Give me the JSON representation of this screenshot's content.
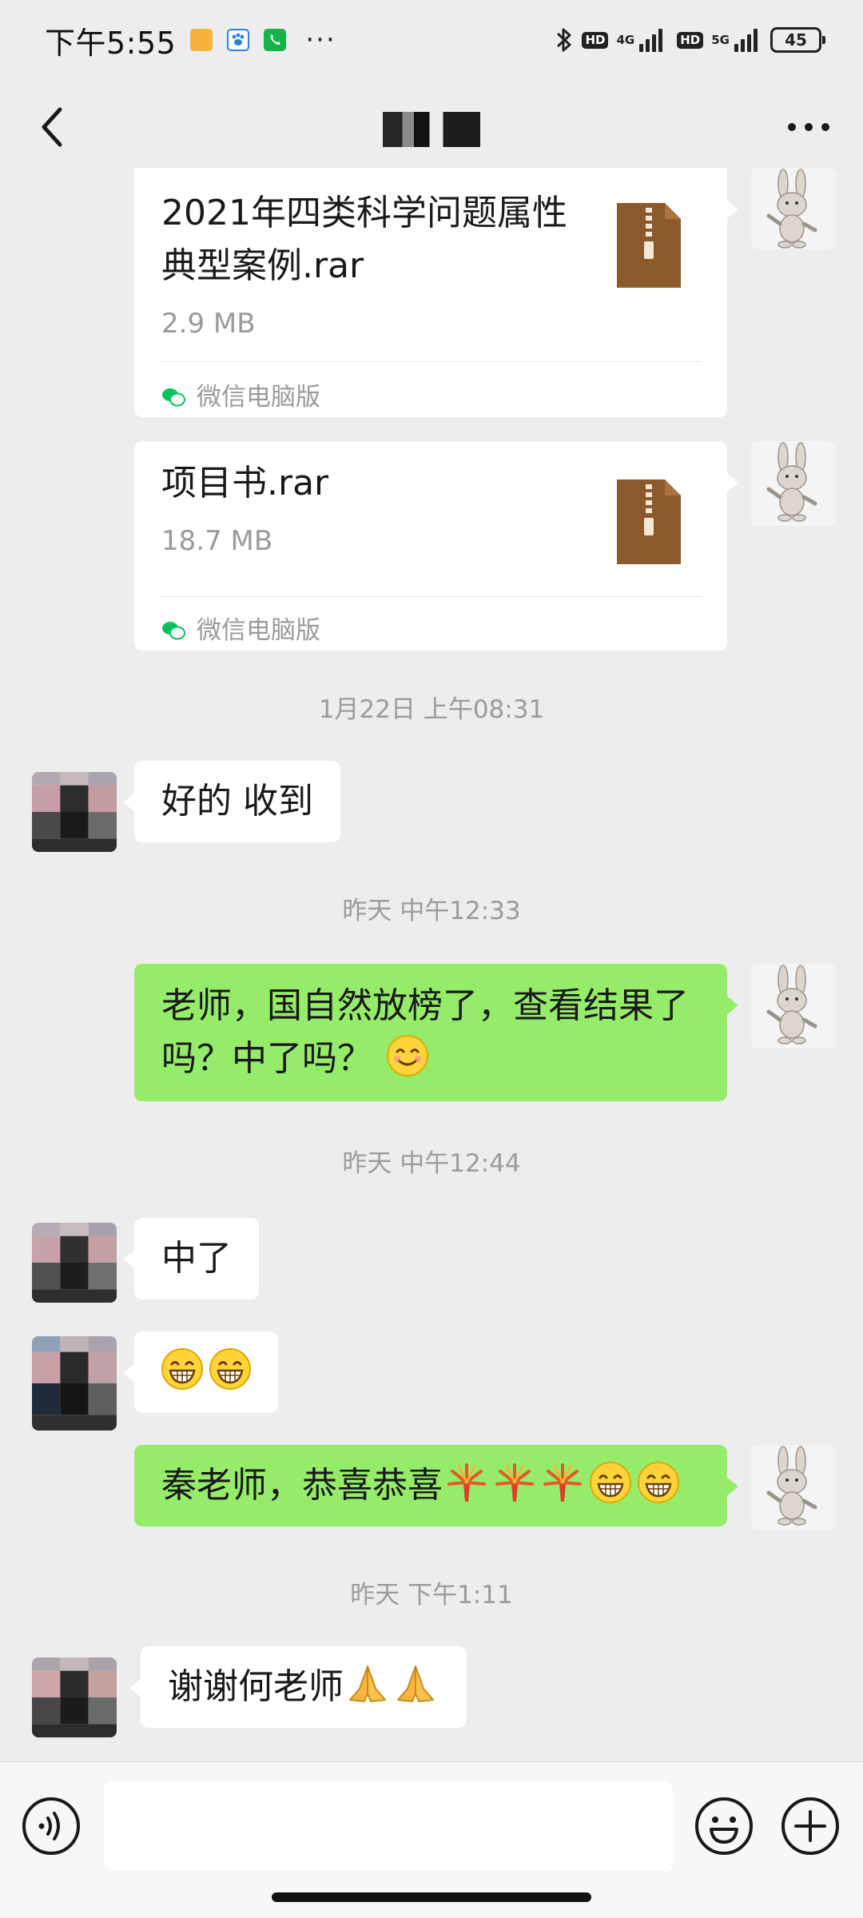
{
  "status_bar": {
    "time": "下午5:55",
    "hd_1": "HD",
    "net_1": "4G",
    "hd_2": "HD",
    "net_2": "5G",
    "battery": "45"
  },
  "colors": {
    "background": "#ededed",
    "sent_bubble": "#95ec69",
    "received_bubble": "#ffffff",
    "file_icon": "#8b5a2b",
    "wechat_green": "#07c160"
  },
  "messages": {
    "file1": {
      "name": "2021年四类科学问题属性典型案例.rar",
      "size": "2.9 MB",
      "source": "微信电脑版"
    },
    "file2": {
      "name": "项目书.rar",
      "size": "18.7 MB",
      "source": "微信电脑版"
    },
    "time1": "1月22日 上午08:31",
    "reply1": "好的 收到",
    "time2": "昨天 中午12:33",
    "sent2": "老师，国自然放榜了，查看结果了吗？中了吗？",
    "time3": "昨天 中午12:44",
    "reply3": "中了",
    "sent4": "秦老师，恭喜恭喜",
    "time4": "昨天 下午1:11",
    "reply5": "谢谢何老师"
  },
  "input": {
    "value": ""
  }
}
